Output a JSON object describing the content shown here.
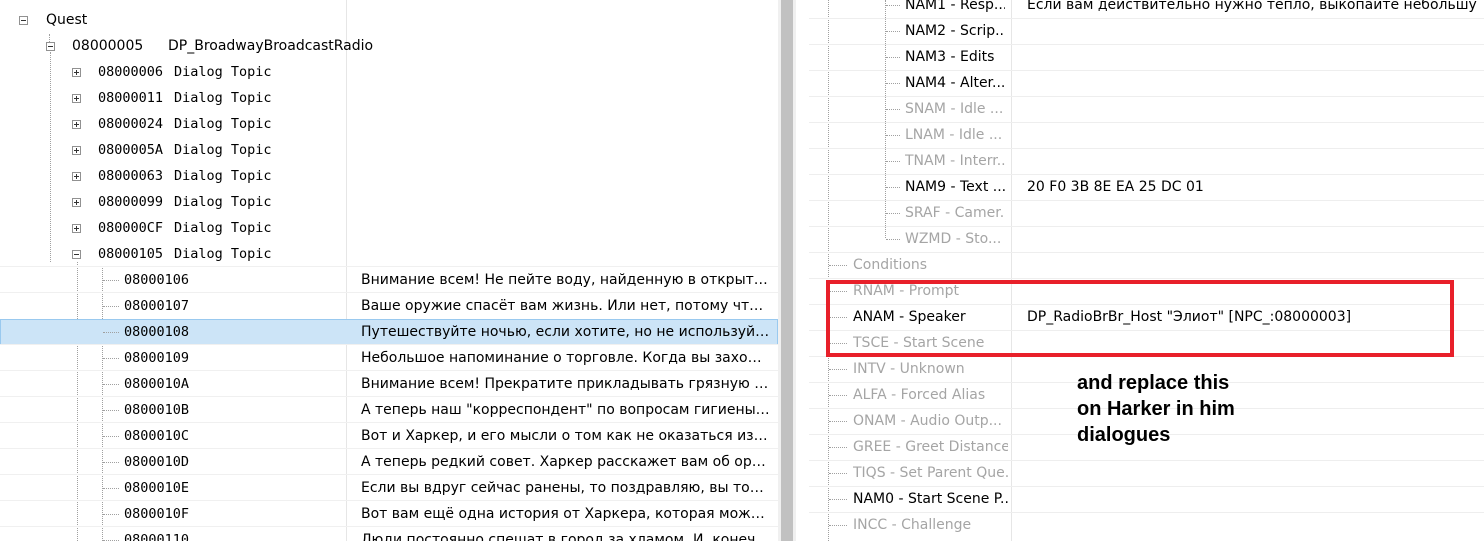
{
  "left_tree": {
    "quest_label": "Quest",
    "quest_id": "08000005",
    "quest_name": "DP_BroadwayBroadcastRadio",
    "topics": [
      {
        "id": "08000006",
        "label": "Dialog Topic"
      },
      {
        "id": "08000011",
        "label": "Dialog Topic"
      },
      {
        "id": "08000024",
        "label": "Dialog Topic"
      },
      {
        "id": "0800005A",
        "label": "Dialog Topic"
      },
      {
        "id": "08000063",
        "label": "Dialog Topic"
      },
      {
        "id": "08000099",
        "label": "Dialog Topic"
      },
      {
        "id": "080000CF",
        "label": "Dialog Topic"
      },
      {
        "id": "08000105",
        "label": "Dialog Topic"
      }
    ],
    "infos": [
      {
        "id": "08000106",
        "text": "Внимание всем! Не пейте воду, найденную в открытом в..."
      },
      {
        "id": "08000107",
        "text": "Ваше оружие спасёт вам жизнь. Или нет, потому что вам..."
      },
      {
        "id": "08000108",
        "text": "Путешествуйте ночью, если хотите, но не используйте пр..."
      },
      {
        "id": "08000109",
        "text": "Небольшое напоминание о торговле. Когда вы заходите..."
      },
      {
        "id": "0800010A",
        "text": "Внимание всем! Прекратите прикладывать грязную ткан..."
      },
      {
        "id": "0800010B",
        "text": "А теперь наш \"корреспондент\" по вопросам гигиены му..."
      },
      {
        "id": "0800010C",
        "text": "Вот и Харкер, и его мысли о том как не оказаться изреш..."
      },
      {
        "id": "0800010D",
        "text": "А теперь редкий совет. Харкер расскажет вам об оружии..."
      },
      {
        "id": "0800010E",
        "text": "Если вы вдруг сейчас ранены, то поздравляю, вы только ..."
      },
      {
        "id": "0800010F",
        "text": "Вот вам ещё одна история от Харкера, которая может сп..."
      },
      {
        "id": "08000110",
        "text": "Люди постоянно спешат в город за хламом. И, конечно..."
      }
    ]
  },
  "right_fields": [
    {
      "name": "NAM1 - Resp...",
      "value": "Если вам действительно нужно тепло, выкопайте небольшую яму",
      "dim": false
    },
    {
      "name": "NAM2 - Scrip...",
      "value": "",
      "dim": false
    },
    {
      "name": "NAM3 - Edits",
      "value": "",
      "dim": false
    },
    {
      "name": "NAM4 - Alter...",
      "value": "",
      "dim": false
    },
    {
      "name": "SNAM - Idle ...",
      "value": "",
      "dim": true
    },
    {
      "name": "LNAM - Idle ...",
      "value": "",
      "dim": true
    },
    {
      "name": "TNAM - Interr...",
      "value": "",
      "dim": true
    },
    {
      "name": "NAM9 - Text ...",
      "value": "20 F0 3B 8E EA 25 DC 01",
      "dim": false
    },
    {
      "name": "SRAF - Camer...",
      "value": "",
      "dim": true
    },
    {
      "name": "WZMD - Sto...",
      "value": "",
      "dim": true
    },
    {
      "name": "Conditions",
      "value": "",
      "dim": true
    },
    {
      "name": "RNAM - Prompt",
      "value": "",
      "dim": true
    },
    {
      "name": "ANAM - Speaker",
      "value": "DP_RadioBrBr_Host \"Элиот\" [NPC_:08000003]",
      "dim": false
    },
    {
      "name": "TSCE - Start Scene",
      "value": "",
      "dim": true
    },
    {
      "name": "INTV - Unknown",
      "value": "",
      "dim": true
    },
    {
      "name": "ALFA - Forced Alias",
      "value": "",
      "dim": true
    },
    {
      "name": "ONAM - Audio Outp...",
      "value": "",
      "dim": true
    },
    {
      "name": "GREE - Greet Distance",
      "value": "",
      "dim": true
    },
    {
      "name": "TIQS - Set Parent Que...",
      "value": "",
      "dim": true
    },
    {
      "name": "NAM0 - Start Scene P...",
      "value": "",
      "dim": false
    },
    {
      "name": "INCC - Challenge",
      "value": "",
      "dim": true
    }
  ],
  "annotation": {
    "line1": "and replace this",
    "line2": "on Harker in him",
    "line3": "dialogues",
    "color": "#e8202a"
  },
  "selected_info_id": "08000108"
}
